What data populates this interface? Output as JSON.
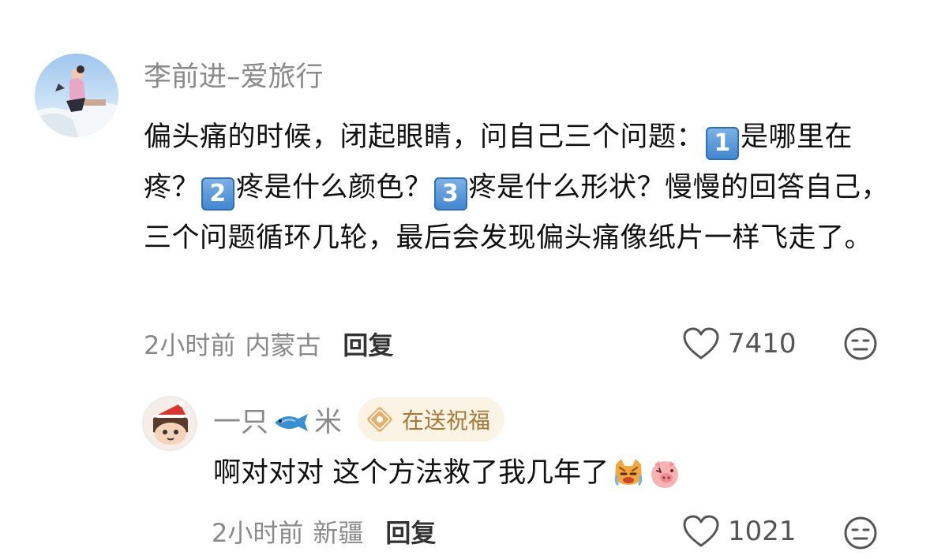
{
  "comment": {
    "author": "李前进–爱旅行",
    "content": {
      "part1": "偏头痛的时候，闭起眼睛，问自己三个问题：",
      "k1": "1",
      "part2": "是哪里在疼？",
      "k2": "2",
      "part3": "疼是什么颜色？",
      "k3": "3",
      "part4": "疼是什么形状？慢慢的回答自己，三个问题循环几轮，最后会发现偏头痛像纸片一样飞走了。"
    },
    "time": "2小时前",
    "location": "内蒙古",
    "reply_label": "回复",
    "likes": "7410",
    "like_icon": "heart-outline-icon",
    "more_icon": "meh-face-icon"
  },
  "reply": {
    "author_prefix": "一只",
    "author_suffix": "米",
    "author_icon": "fish-icon",
    "badge_label": "在送祝福",
    "badge_icon": "blessing-icon",
    "content": "啊对对对 这个方法救了我几年了",
    "emojis": [
      "crying-cat-emoji",
      "pig-face-emoji"
    ],
    "time": "2小时前",
    "location": "新疆",
    "reply_label": "回复",
    "likes": "1021",
    "like_icon": "heart-outline-icon",
    "more_icon": "meh-face-icon"
  },
  "colors": {
    "meta_gray": "#8a8a8a",
    "text": "#111111",
    "badge_bg": "#fbf3e4",
    "badge_text": "#a5793a",
    "keycap_blue": "#3f85cf"
  }
}
